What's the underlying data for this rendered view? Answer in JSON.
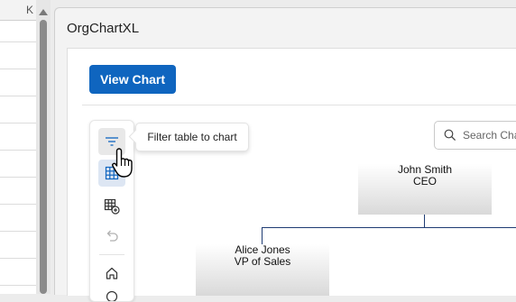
{
  "spreadsheet": {
    "column_header": "K"
  },
  "pane": {
    "title": "OrgChartXL",
    "view_chart_label": "View Chart",
    "tooltip": "Filter table to chart",
    "search_placeholder": "Search Cha"
  },
  "toolbar": {
    "buttons": [
      "filter-icon",
      "table-icon",
      "add-table-icon",
      "undo-icon",
      "home-icon"
    ]
  },
  "chart": {
    "nodes": [
      {
        "name": "John Smith",
        "title": "CEO"
      },
      {
        "name": "Alice Jones",
        "title": "VP of Sales"
      }
    ]
  },
  "colors": {
    "accent": "#0f65bf",
    "connector": "#1f3c73"
  }
}
